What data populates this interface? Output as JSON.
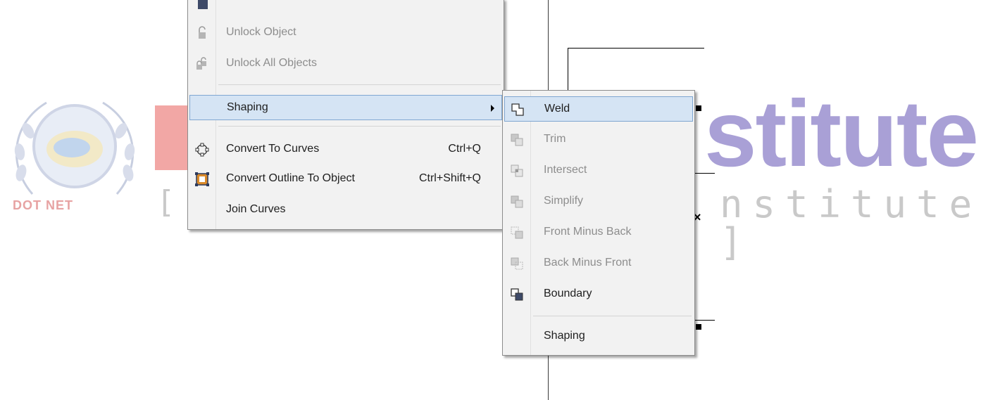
{
  "watermark": {
    "logo_text": "DOT NET",
    "brand_partial": "stitute",
    "brand_sub_partial": "nstitute ]",
    "bracket_left": "[",
    "colors": {
      "brand": "#a9a0d6",
      "red": "#f2a7a5",
      "gray": "#c9c9c9"
    }
  },
  "context_menu": {
    "items": [
      {
        "label": "Unlock Object",
        "icon": "unlock-icon",
        "enabled": false
      },
      {
        "label": "Unlock All Objects",
        "icon": "unlock-all-icon",
        "enabled": false
      },
      {
        "label": "Shaping",
        "icon": "",
        "submenu": true,
        "highlighted": true
      },
      {
        "label": "Convert To Curves",
        "shortcut": "Ctrl+Q",
        "icon": "convert-to-curves-icon"
      },
      {
        "label": "Convert Outline To Object",
        "shortcut": "Ctrl+Shift+Q",
        "icon": "convert-outline-icon"
      },
      {
        "label": "Join Curves",
        "icon": ""
      }
    ]
  },
  "shaping_submenu": {
    "items": [
      {
        "label": "Weld",
        "icon": "weld-icon",
        "enabled": true,
        "highlighted": true
      },
      {
        "label": "Trim",
        "icon": "trim-icon",
        "enabled": false
      },
      {
        "label": "Intersect",
        "icon": "intersect-icon",
        "enabled": false
      },
      {
        "label": "Simplify",
        "icon": "simplify-icon",
        "enabled": false
      },
      {
        "label": "Front Minus Back",
        "icon": "front-minus-back-icon",
        "enabled": false
      },
      {
        "label": "Back Minus Front",
        "icon": "back-minus-front-icon",
        "enabled": false
      },
      {
        "label": "Boundary",
        "icon": "boundary-icon",
        "enabled": true
      },
      {
        "label": "Shaping",
        "icon": "",
        "enabled": true
      }
    ]
  },
  "canvas": {
    "marker_x": "×"
  },
  "colors": {
    "highlight_bg": "#d5e4f4",
    "highlight_border": "#7fa6d1",
    "menu_bg": "#f2f2f2",
    "disabled_text": "#8d8d8d"
  }
}
